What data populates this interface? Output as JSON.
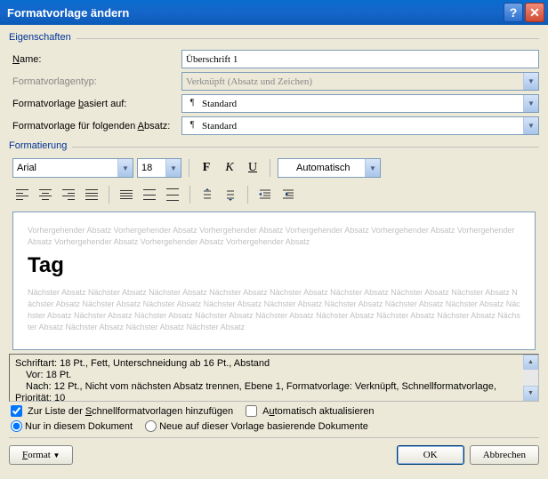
{
  "window": {
    "title": "Formatvorlage ändern"
  },
  "sections": {
    "properties": "Eigenschaften",
    "formatting": "Formatierung"
  },
  "labels": {
    "name": "Name:",
    "styleType": "Formatvorlagentyp:",
    "basedOn": "Formatvorlage basiert auf:",
    "following": "Formatvorlage für folgenden Absatz:"
  },
  "values": {
    "name": "Überschrift 1",
    "styleType": "Verknüpft (Absatz und Zeichen)",
    "basedOn": "Standard",
    "following": "Standard",
    "font": "Arial",
    "size": "18",
    "color": "Automatisch"
  },
  "preview": {
    "before": "Vorhergehender Absatz Vorhergehender Absatz Vorhergehender Absatz Vorhergehender Absatz Vorhergehender Absatz Vorhergehender Absatz Vorhergehender Absatz Vorhergehender Absatz Vorhergehender Absatz",
    "sample": "Tag",
    "after": "Nächster Absatz Nächster Absatz Nächster Absatz Nächster Absatz Nächster Absatz Nächster Absatz Nächster Absatz Nächster Absatz Nächster Absatz Nächster Absatz Nächster Absatz Nächster Absatz Nächster Absatz Nächster Absatz Nächster Absatz Nächster Absatz Nächster Absatz Nächster Absatz Nächster Absatz Nächster Absatz Nächster Absatz Nächster Absatz Nächster Absatz Nächster Absatz Nächster Absatz Nächster Absatz Nächster Absatz Nächster Absatz"
  },
  "description": {
    "line1": "Schriftart: 18 Pt., Fett, Unterschneidung ab 16 Pt., Abstand",
    "line2": "Vor:  18 Pt.",
    "line3": "Nach:  12 Pt., Nicht vom nächsten Absatz trennen, Ebene 1, Formatvorlage: Verknüpft, Schnellformatvorlage,",
    "line4": "Priorität: 10"
  },
  "checkboxes": {
    "addToQuick": "Zur Liste der Schnellformatvorlagen hinzufügen",
    "autoUpdate": "Automatisch aktualisieren"
  },
  "radios": {
    "thisDoc": "Nur in diesem Dokument",
    "newDocs": "Neue auf dieser Vorlage basierende Dokumente"
  },
  "buttons": {
    "format": "Format",
    "ok": "OK",
    "cancel": "Abbrechen"
  }
}
